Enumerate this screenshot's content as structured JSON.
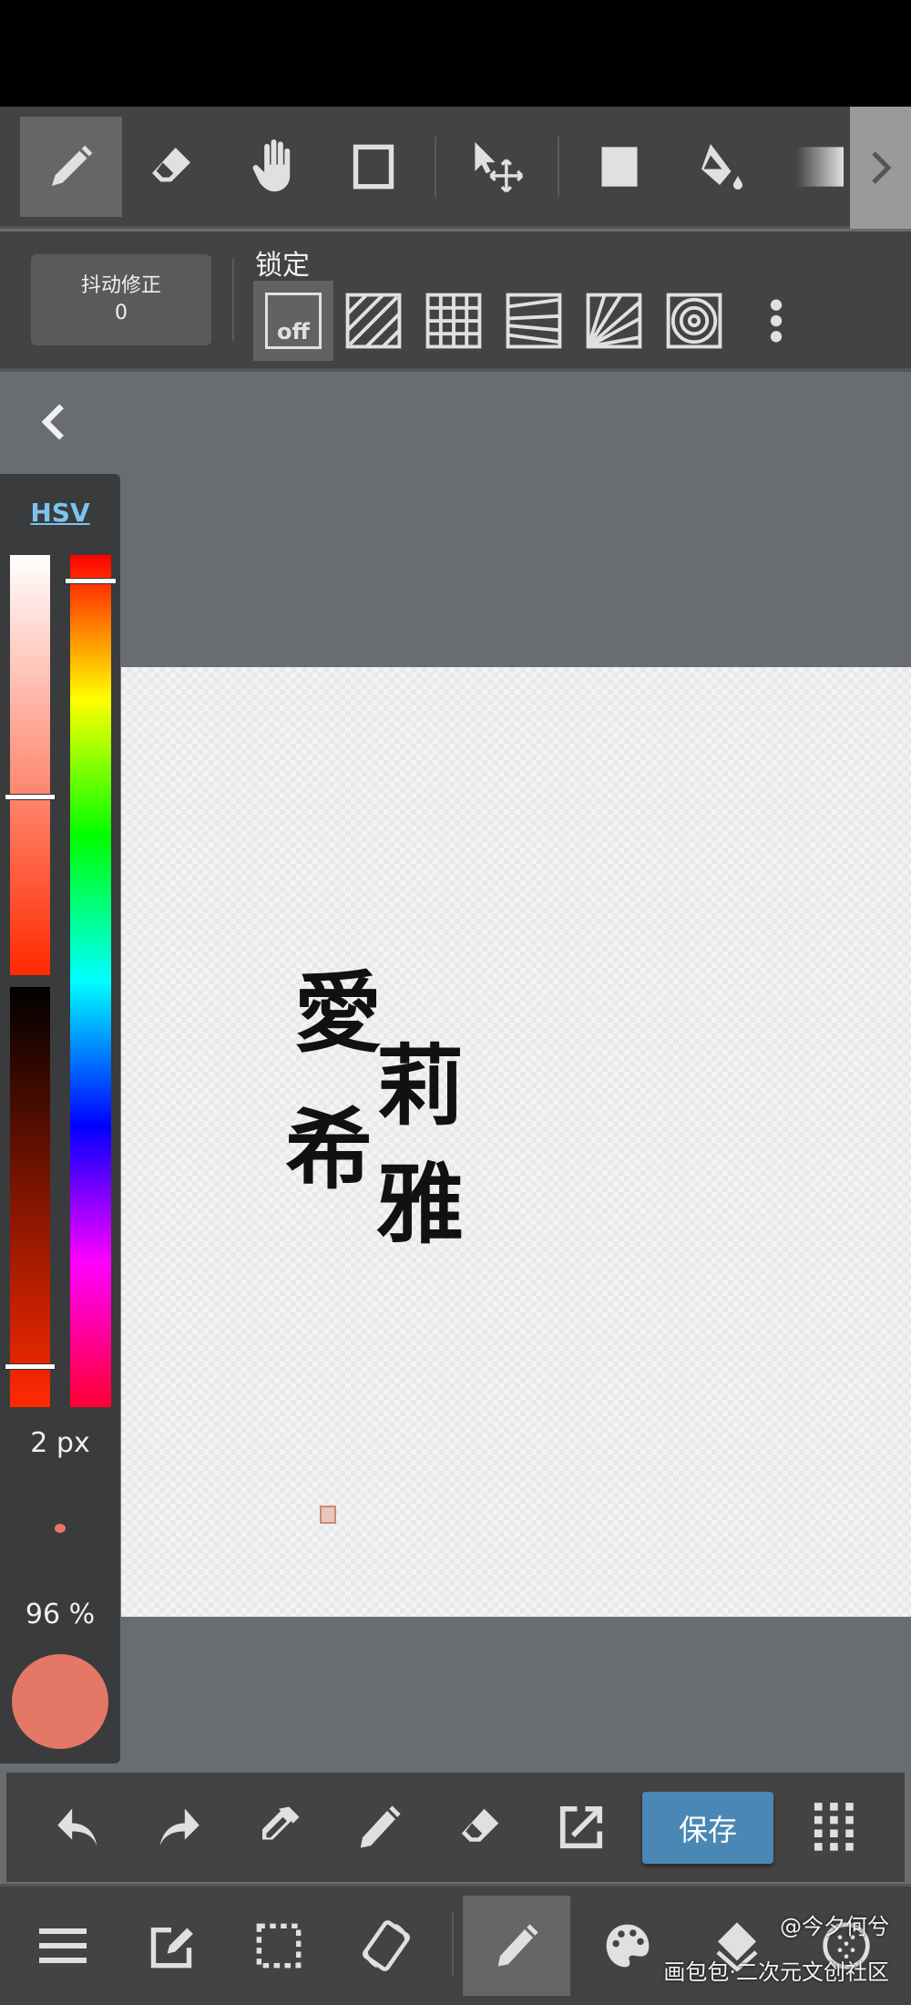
{
  "toolbar": {
    "tools": [
      "pen",
      "eraser",
      "hand",
      "rectangle",
      "move",
      "fill-rect",
      "bucket",
      "gradient"
    ],
    "selected": "pen"
  },
  "stabilizer": {
    "label": "抖动修正",
    "value": "0"
  },
  "lock": {
    "label": "锁定",
    "off_label": "off",
    "options": [
      "off",
      "parallel",
      "grid",
      "perspective",
      "radial",
      "concentric"
    ],
    "selected": "off"
  },
  "color_panel": {
    "mode": "HSV",
    "hue_deg": 0,
    "saturation_pct": 58,
    "value_pct": 96,
    "brush_size": "2 px",
    "opacity": "96 %",
    "current_color": "#e57766",
    "accent": "#7cc4ef"
  },
  "canvas": {
    "artwork_text": "愛莉希雅"
  },
  "bottom": {
    "save_label": "保存",
    "save_color": "#4a87b5"
  },
  "nav": {
    "selected": "brush"
  },
  "watermark": {
    "line1": "@今夕何兮",
    "line2": "画包包·二次元文创社区"
  }
}
